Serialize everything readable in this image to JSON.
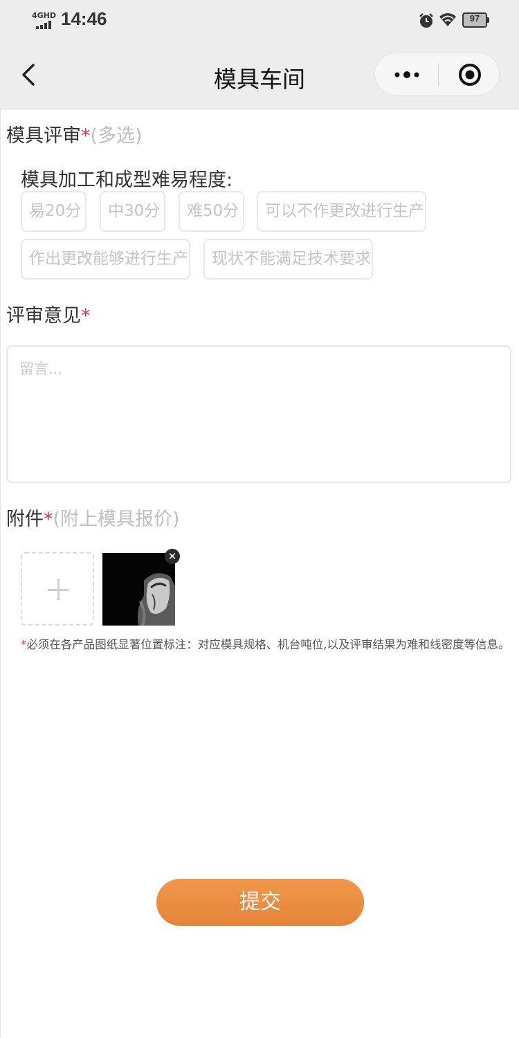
{
  "status_bar": {
    "network": "4GHD",
    "time": "14:46",
    "battery": "97"
  },
  "nav": {
    "title": "模具车间",
    "more_icon": "more-dots-icon",
    "close_icon": "target-circle-icon"
  },
  "review_section": {
    "title": "模具评审",
    "required_mark": "*",
    "hint": "(多选)",
    "sub_label": "模具加工和成型难易程度:",
    "options": [
      "易20分",
      "中30分",
      "难50分",
      "可以不作更改进行生产",
      "作出更改能够进行生产",
      "现状不能满足技术要求"
    ]
  },
  "opinion_section": {
    "title": "评审意见",
    "required_mark": "*",
    "placeholder": "留言..."
  },
  "attachment_section": {
    "title": "附件",
    "required_mark": "*",
    "hint": "(附上模具报价)",
    "add_icon": "plus-icon",
    "remove_icon": "close-icon",
    "note_mark": "*",
    "note": "必须在各产品图纸显著位置标注：对应模具规格、机台吨位,以及评审结果为难和线密度等信息。"
  },
  "submit_label": "提交",
  "colors": {
    "accent": "#e98c40",
    "required": "#e0323f",
    "nav_bg": "#ededed"
  }
}
